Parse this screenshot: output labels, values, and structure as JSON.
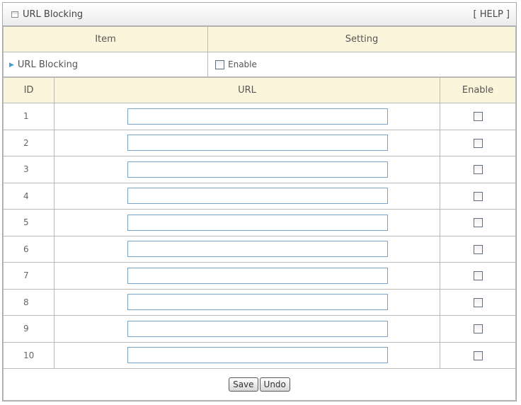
{
  "panel": {
    "title": "URL Blocking",
    "help_label": "[ HELP ]"
  },
  "config_header": {
    "item": "Item",
    "setting": "Setting"
  },
  "config_row": {
    "label": "URL Blocking",
    "enable_label": "Enable",
    "enabled": false
  },
  "grid": {
    "columns": [
      "ID",
      "URL",
      "Enable"
    ],
    "rows": [
      {
        "id": "1",
        "url": "",
        "enabled": false
      },
      {
        "id": "2",
        "url": "",
        "enabled": false
      },
      {
        "id": "3",
        "url": "",
        "enabled": false
      },
      {
        "id": "4",
        "url": "",
        "enabled": false
      },
      {
        "id": "5",
        "url": "",
        "enabled": false
      },
      {
        "id": "6",
        "url": "",
        "enabled": false
      },
      {
        "id": "7",
        "url": "",
        "enabled": false
      },
      {
        "id": "8",
        "url": "",
        "enabled": false
      },
      {
        "id": "9",
        "url": "",
        "enabled": false
      },
      {
        "id": "10",
        "url": "",
        "enabled": false
      }
    ]
  },
  "buttons": {
    "save": "Save",
    "undo": "Undo"
  }
}
